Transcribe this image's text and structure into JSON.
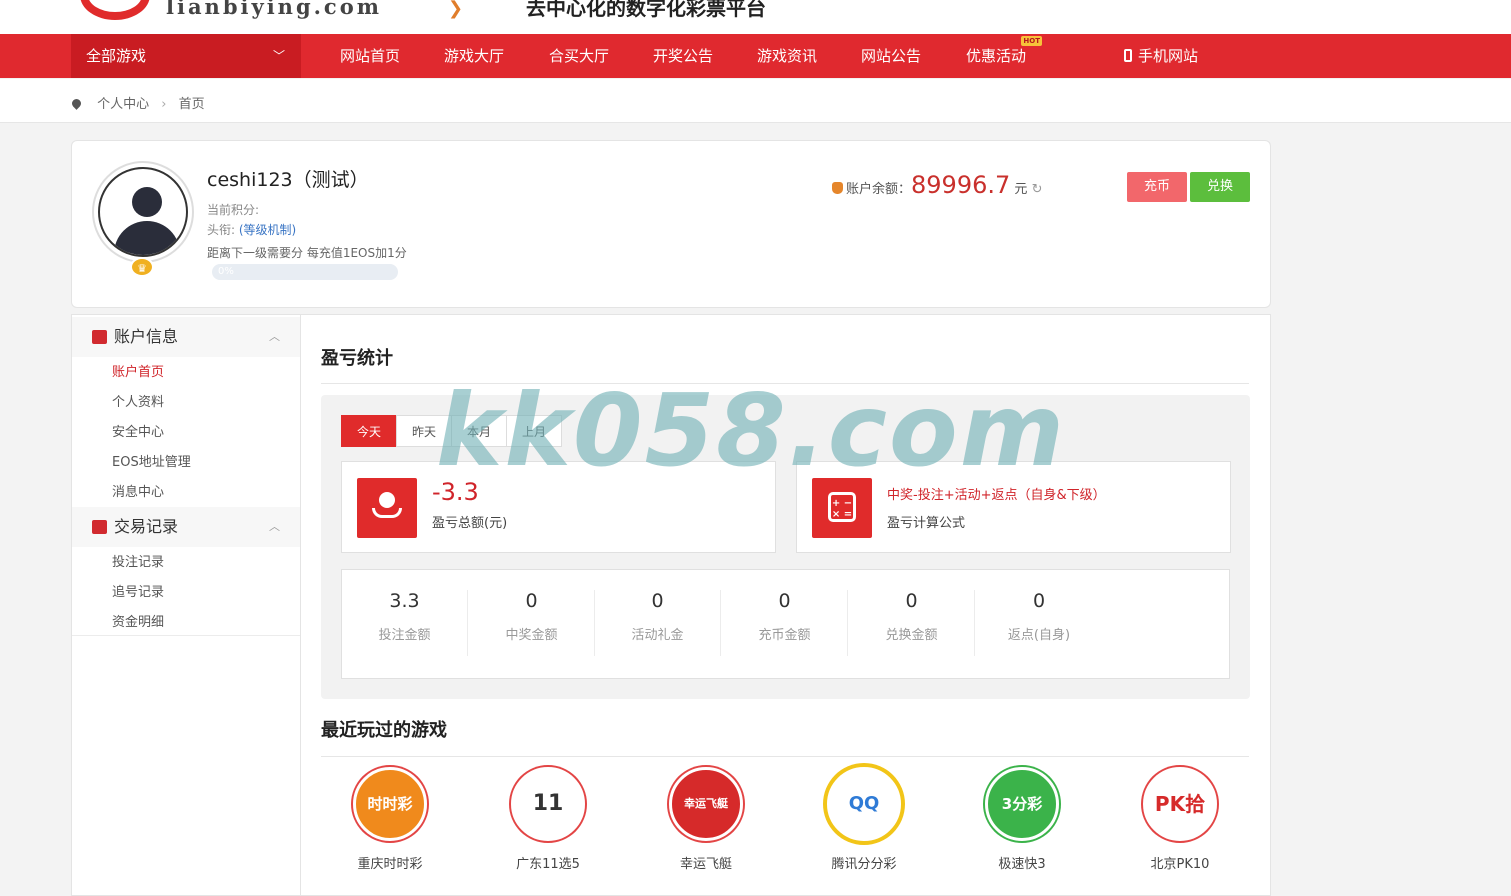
{
  "header": {
    "logo_text": "lianbiying.com",
    "slogan": "去中心化的数字化彩票平台"
  },
  "nav": {
    "all_games": "全部游戏",
    "items": [
      "网站首页",
      "游戏大厅",
      "合买大厅",
      "开奖公告",
      "游戏资讯",
      "网站公告",
      "优惠活动"
    ],
    "hot_badge": "HOT",
    "mobile": "手机网站"
  },
  "breadcrumb": {
    "items": [
      "个人中心",
      "首页"
    ]
  },
  "profile": {
    "username": "ceshi123（测试）",
    "points_label": "当前积分:",
    "title_label": "头衔:",
    "level_link": "(等级机制)",
    "next_level": "距离下一级需要分 每充值1EOS加1分",
    "progress_text": "0%",
    "progress": 0,
    "balance_label": "账户余额：",
    "balance_value": "89996.7",
    "balance_unit": "元",
    "recharge_btn": "充币",
    "exchange_btn": "兑换"
  },
  "sidebar": {
    "account_title": "账户信息",
    "account_items": [
      "账户首页",
      "个人资料",
      "安全中心",
      "EOS地址管理",
      "消息中心"
    ],
    "trade_title": "交易记录",
    "trade_items": [
      "投注记录",
      "追号记录",
      "资金明细"
    ]
  },
  "stats": {
    "title": "盈亏统计",
    "tabs": [
      "今天",
      "昨天",
      "本月",
      "上月"
    ],
    "total_value": "-3.3",
    "total_label": "盈亏总额(元)",
    "formula": "中奖-投注+活动+返点（自身&下级）",
    "formula_label": "盈亏计算公式",
    "items": [
      {
        "value": "3.3",
        "label": "投注金额"
      },
      {
        "value": "0",
        "label": "中奖金额"
      },
      {
        "value": "0",
        "label": "活动礼金"
      },
      {
        "value": "0",
        "label": "充币金额"
      },
      {
        "value": "0",
        "label": "兑换金额"
      },
      {
        "value": "0",
        "label": "返点(自身)"
      }
    ]
  },
  "recent": {
    "title": "最近玩过的游戏",
    "games": [
      {
        "name": "重庆时时彩",
        "icon": "lottery-ssc-icon",
        "color": "#f08a1c",
        "glyph": "时时彩"
      },
      {
        "name": "广东11选5",
        "icon": "gd11x5-icon",
        "color": "#ffffff",
        "glyph": "11"
      },
      {
        "name": "幸运飞艇",
        "icon": "airship-icon",
        "color": "#d62a2a",
        "glyph": "幸运飞艇"
      },
      {
        "name": "腾讯分分彩",
        "icon": "tencent-icon",
        "color": "#ffffff",
        "glyph": "QQ"
      },
      {
        "name": "极速快3",
        "icon": "dice-icon",
        "color": "#3bb34a",
        "glyph": "3分彩"
      },
      {
        "name": "北京PK10",
        "icon": "pk10-icon",
        "color": "#ffffff",
        "glyph": "PK拾"
      }
    ]
  },
  "watermark": "kk058.com"
}
